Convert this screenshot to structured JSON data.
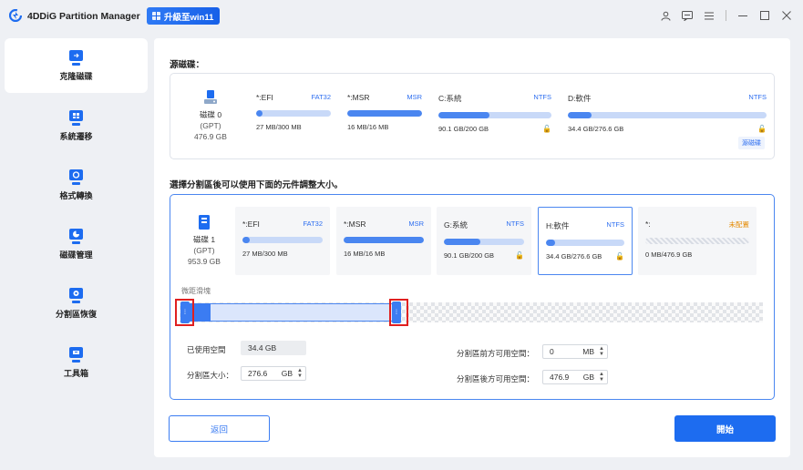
{
  "app": {
    "title": "4DDiG Partition Manager",
    "upgrade_label": "升級至win11"
  },
  "window_controls": [
    "user-icon",
    "feedback-icon",
    "menu-icon",
    "minimize-icon",
    "maximize-icon",
    "close-icon"
  ],
  "sidebar": {
    "items": [
      {
        "label": "克隆磁碟",
        "icon": "clone-disk-icon",
        "active": true
      },
      {
        "label": "系統遷移",
        "icon": "system-migrate-icon",
        "active": false
      },
      {
        "label": "格式轉換",
        "icon": "convert-icon",
        "active": false
      },
      {
        "label": "磁碟管理",
        "icon": "disk-manage-icon",
        "active": false
      },
      {
        "label": "分割區恢復",
        "icon": "partition-recovery-icon",
        "active": false
      },
      {
        "label": "工具箱",
        "icon": "toolbox-icon",
        "active": false
      }
    ]
  },
  "source": {
    "title": "源磁碟：",
    "disk": {
      "name": "磁碟 0",
      "type": "(GPT)",
      "size": "476.9 GB"
    },
    "partitions": [
      {
        "name": "*:EFI",
        "fs": "FAT32",
        "size": "27 MB/300 MB",
        "used": 0.09
      },
      {
        "name": "*:MSR",
        "fs": "MSR",
        "size": "16 MB/16 MB",
        "used": 1.0
      },
      {
        "name": "C:系統",
        "fs": "NTFS",
        "size": "90.1 GB/200 GB",
        "used": 0.45
      },
      {
        "name": "D:軟件",
        "fs": "NTFS",
        "size": "34.4 GB/276.6 GB",
        "used": 0.12
      }
    ],
    "tag": "源磁碟"
  },
  "target": {
    "title": "選擇分割區後可以使用下面的元件調整大小。",
    "disk": {
      "name": "磁碟 1",
      "type": "(GPT)",
      "size": "953.9 GB"
    },
    "partitions": [
      {
        "name": "*:EFI",
        "fs": "FAT32",
        "size": "27 MB/300 MB",
        "used": 0.09
      },
      {
        "name": "*:MSR",
        "fs": "MSR",
        "size": "16 MB/16 MB",
        "used": 1.0
      },
      {
        "name": "G:系統",
        "fs": "NTFS",
        "size": "90.1 GB/200 GB",
        "used": 0.45
      },
      {
        "name": "H:軟件",
        "fs": "NTFS",
        "size": "34.4 GB/276.6 GB",
        "used": 0.12
      },
      {
        "name": "*:",
        "fs": "未配置",
        "size": "0 MB/476.9 GB",
        "used": 0.0
      }
    ]
  },
  "slider": {
    "label": "微距滑塊"
  },
  "fields": {
    "used_label": "已使用空間",
    "used_value": "34.4 GB",
    "size_label": "分割區大小：",
    "size_value": "276.6",
    "size_unit": "GB",
    "before_label": "分割區前方可用空間：",
    "before_value": "0",
    "before_unit": "MB",
    "after_label": "分割區後方可用空間：",
    "after_value": "476.9",
    "after_unit": "GB"
  },
  "buttons": {
    "back": "返回",
    "start": "開始"
  },
  "colors": {
    "accent": "#1d6cf0",
    "highlight": "#e02020"
  }
}
